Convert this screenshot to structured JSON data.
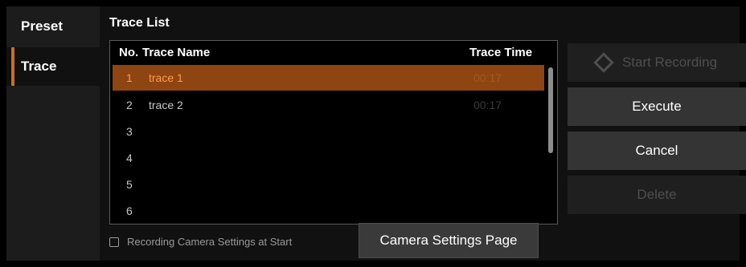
{
  "sidebar": {
    "items": [
      {
        "label": "Preset"
      },
      {
        "label": "Trace"
      }
    ]
  },
  "panel": {
    "title": "Trace List"
  },
  "list": {
    "headers": {
      "no": "No.",
      "name": "Trace Name",
      "time": "Trace Time"
    },
    "rows": [
      {
        "no": "1",
        "name": "trace 1",
        "time": "00:17",
        "selected": true
      },
      {
        "no": "2",
        "name": "trace 2",
        "time": "00:17"
      },
      {
        "no": "3",
        "name": "",
        "time": ""
      },
      {
        "no": "4",
        "name": "",
        "time": ""
      },
      {
        "no": "5",
        "name": "",
        "time": ""
      },
      {
        "no": "6",
        "name": "",
        "time": ""
      }
    ]
  },
  "checkbox": {
    "label": "Recording Camera Settings at Start",
    "checked": false
  },
  "buttons": {
    "camera_settings": "Camera Settings Page",
    "start_recording": "Start Recording",
    "execute": "Execute",
    "cancel": "Cancel",
    "delete": "Delete"
  },
  "colors": {
    "accent": "#cf6d22",
    "selected_row": "#8e4512"
  },
  "icons": {
    "start_recording": "diamond-icon"
  }
}
